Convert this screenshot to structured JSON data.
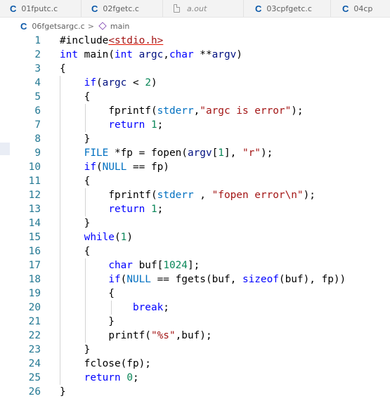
{
  "tabs": [
    {
      "label": "01fputc.c",
      "icon": "c-file-icon"
    },
    {
      "label": "02fgetc.c",
      "icon": "c-file-icon"
    },
    {
      "label": "a.out",
      "icon": "generic-file-icon"
    },
    {
      "label": "03cpfgetc.c",
      "icon": "c-file-icon"
    },
    {
      "label": "04cp",
      "icon": "c-file-icon"
    }
  ],
  "breadcrumb": {
    "file": "06fgetsargc.c",
    "symbol": "main",
    "separator": ">"
  },
  "lines": [
    {
      "n": "1",
      "tokens": [
        {
          "t": "#include",
          "c": "t-pp"
        },
        {
          "t": "<stdio.h>",
          "c": "t-hdr"
        }
      ]
    },
    {
      "n": "2",
      "tokens": [
        {
          "t": "int ",
          "c": "t-kw"
        },
        {
          "t": "main",
          "c": "t-fn"
        },
        {
          "t": "(",
          "c": "t-punct"
        },
        {
          "t": "int ",
          "c": "t-kw"
        },
        {
          "t": "argc",
          "c": "t-param"
        },
        {
          "t": ",",
          "c": "t-punct"
        },
        {
          "t": "char ",
          "c": "t-kw"
        },
        {
          "t": "**",
          "c": "t-punct"
        },
        {
          "t": "argv",
          "c": "t-param"
        },
        {
          "t": ")",
          "c": "t-punct"
        }
      ]
    },
    {
      "n": "3",
      "tokens": [
        {
          "t": "{",
          "c": "t-punct"
        }
      ]
    },
    {
      "n": "4",
      "tokens": [
        {
          "t": "    ",
          "c": "t-punct"
        },
        {
          "t": "if",
          "c": "t-kw"
        },
        {
          "t": "(",
          "c": "t-punct"
        },
        {
          "t": "argc",
          "c": "t-param"
        },
        {
          "t": " < ",
          "c": "t-punct"
        },
        {
          "t": "2",
          "c": "t-num"
        },
        {
          "t": ")",
          "c": "t-punct"
        }
      ]
    },
    {
      "n": "5",
      "tokens": [
        {
          "t": "    {",
          "c": "t-punct"
        }
      ]
    },
    {
      "n": "6",
      "tokens": [
        {
          "t": "        ",
          "c": "t-punct"
        },
        {
          "t": "fprintf",
          "c": "t-fn"
        },
        {
          "t": "(",
          "c": "t-punct"
        },
        {
          "t": "stderr",
          "c": "t-const"
        },
        {
          "t": ",",
          "c": "t-punct"
        },
        {
          "t": "\"argc is error\"",
          "c": "t-str"
        },
        {
          "t": ");",
          "c": "t-punct"
        }
      ]
    },
    {
      "n": "7",
      "tokens": [
        {
          "t": "        ",
          "c": "t-punct"
        },
        {
          "t": "return ",
          "c": "t-kw"
        },
        {
          "t": "1",
          "c": "t-num"
        },
        {
          "t": ";",
          "c": "t-punct"
        }
      ]
    },
    {
      "n": "8",
      "tokens": [
        {
          "t": "    }",
          "c": "t-punct"
        }
      ]
    },
    {
      "n": "9",
      "tokens": [
        {
          "t": "    ",
          "c": "t-punct"
        },
        {
          "t": "FILE ",
          "c": "t-const"
        },
        {
          "t": "*fp = ",
          "c": "t-punct"
        },
        {
          "t": "fopen",
          "c": "t-fn"
        },
        {
          "t": "(",
          "c": "t-punct"
        },
        {
          "t": "argv",
          "c": "t-param"
        },
        {
          "t": "[",
          "c": "t-punct"
        },
        {
          "t": "1",
          "c": "t-num"
        },
        {
          "t": "], ",
          "c": "t-punct"
        },
        {
          "t": "\"r\"",
          "c": "t-str"
        },
        {
          "t": ");",
          "c": "t-punct"
        }
      ]
    },
    {
      "n": "10",
      "tokens": [
        {
          "t": "    ",
          "c": "t-punct"
        },
        {
          "t": "if",
          "c": "t-kw"
        },
        {
          "t": "(",
          "c": "t-punct"
        },
        {
          "t": "NULL",
          "c": "t-const"
        },
        {
          "t": " == fp)",
          "c": "t-punct"
        }
      ]
    },
    {
      "n": "11",
      "tokens": [
        {
          "t": "    {",
          "c": "t-punct"
        }
      ]
    },
    {
      "n": "12",
      "tokens": [
        {
          "t": "        ",
          "c": "t-punct"
        },
        {
          "t": "fprintf",
          "c": "t-fn"
        },
        {
          "t": "(",
          "c": "t-punct"
        },
        {
          "t": "stderr",
          "c": "t-const"
        },
        {
          "t": " , ",
          "c": "t-punct"
        },
        {
          "t": "\"fopen error\\n\"",
          "c": "t-str"
        },
        {
          "t": ");",
          "c": "t-punct"
        }
      ]
    },
    {
      "n": "13",
      "tokens": [
        {
          "t": "        ",
          "c": "t-punct"
        },
        {
          "t": "return ",
          "c": "t-kw"
        },
        {
          "t": "1",
          "c": "t-num"
        },
        {
          "t": ";",
          "c": "t-punct"
        }
      ]
    },
    {
      "n": "14",
      "tokens": [
        {
          "t": "    }",
          "c": "t-punct"
        }
      ]
    },
    {
      "n": "15",
      "tokens": [
        {
          "t": "    ",
          "c": "t-punct"
        },
        {
          "t": "while",
          "c": "t-kw"
        },
        {
          "t": "(",
          "c": "t-punct"
        },
        {
          "t": "1",
          "c": "t-num"
        },
        {
          "t": ")",
          "c": "t-punct"
        }
      ]
    },
    {
      "n": "16",
      "tokens": [
        {
          "t": "    {",
          "c": "t-punct"
        }
      ]
    },
    {
      "n": "17",
      "tokens": [
        {
          "t": "        ",
          "c": "t-punct"
        },
        {
          "t": "char ",
          "c": "t-kw"
        },
        {
          "t": "buf",
          "c": "t-id"
        },
        {
          "t": "[",
          "c": "t-punct"
        },
        {
          "t": "1024",
          "c": "t-num"
        },
        {
          "t": "];",
          "c": "t-punct"
        }
      ]
    },
    {
      "n": "18",
      "tokens": [
        {
          "t": "        ",
          "c": "t-punct"
        },
        {
          "t": "if",
          "c": "t-kw"
        },
        {
          "t": "(",
          "c": "t-punct"
        },
        {
          "t": "NULL",
          "c": "t-const"
        },
        {
          "t": " == ",
          "c": "t-punct"
        },
        {
          "t": "fgets",
          "c": "t-fn"
        },
        {
          "t": "(buf, ",
          "c": "t-punct"
        },
        {
          "t": "sizeof",
          "c": "t-kw"
        },
        {
          "t": "(buf), fp))",
          "c": "t-punct"
        }
      ]
    },
    {
      "n": "19",
      "tokens": [
        {
          "t": "        {",
          "c": "t-punct"
        }
      ]
    },
    {
      "n": "20",
      "tokens": [
        {
          "t": "            ",
          "c": "t-punct"
        },
        {
          "t": "break",
          "c": "t-kw"
        },
        {
          "t": ";",
          "c": "t-punct"
        }
      ]
    },
    {
      "n": "21",
      "tokens": [
        {
          "t": "        }",
          "c": "t-punct"
        }
      ]
    },
    {
      "n": "22",
      "tokens": [
        {
          "t": "        ",
          "c": "t-punct"
        },
        {
          "t": "printf",
          "c": "t-fn"
        },
        {
          "t": "(",
          "c": "t-punct"
        },
        {
          "t": "\"%s\"",
          "c": "t-str"
        },
        {
          "t": ",buf);",
          "c": "t-punct"
        }
      ]
    },
    {
      "n": "23",
      "tokens": [
        {
          "t": "    }",
          "c": "t-punct"
        }
      ]
    },
    {
      "n": "24",
      "tokens": [
        {
          "t": "    ",
          "c": "t-punct"
        },
        {
          "t": "fclose",
          "c": "t-fn"
        },
        {
          "t": "(fp);",
          "c": "t-punct"
        }
      ]
    },
    {
      "n": "25",
      "tokens": [
        {
          "t": "    ",
          "c": "t-punct"
        },
        {
          "t": "return ",
          "c": "t-kw"
        },
        {
          "t": "0",
          "c": "t-num"
        },
        {
          "t": ";",
          "c": "t-punct"
        }
      ]
    },
    {
      "n": "26",
      "tokens": [
        {
          "t": "}",
          "c": "t-punct"
        }
      ]
    }
  ]
}
